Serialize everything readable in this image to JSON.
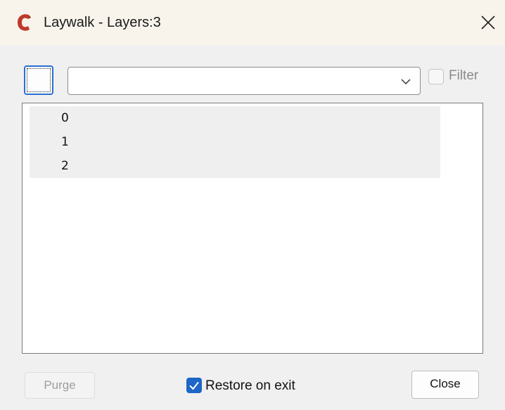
{
  "window": {
    "title": "Laywalk - Layers:3",
    "app_icon": "laywalk-c-logo-icon",
    "close_icon": "close-icon"
  },
  "toolbar": {
    "select_all_checked": false,
    "layer_combo_value": "",
    "combo_icon": "chevron-down-icon",
    "filter_label": "Filter",
    "filter_checked": false
  },
  "layers": [
    {
      "name": "0"
    },
    {
      "name": "1"
    },
    {
      "name": "2"
    }
  ],
  "footer": {
    "purge_label": "Purge",
    "restore_label": "Restore on exit",
    "restore_checked": true,
    "close_label": "Close"
  },
  "colors": {
    "accent": "#1e66c8",
    "brand_logo": "#c0392b",
    "titlebar_bg": "#f8f4ec"
  }
}
